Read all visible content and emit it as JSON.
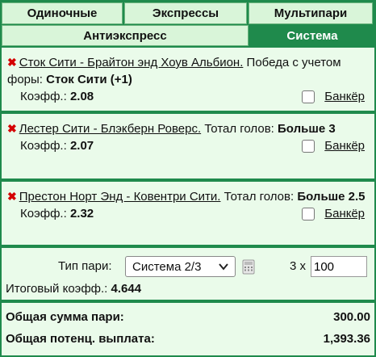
{
  "tabs": {
    "row1": [
      {
        "label": "Одиночные",
        "active": false
      },
      {
        "label": "Экспрессы",
        "active": false
      },
      {
        "label": "Мультипари",
        "active": false
      }
    ],
    "row2": [
      {
        "label": "Антиэкспресс",
        "active": false
      },
      {
        "label": "Система",
        "active": true
      }
    ]
  },
  "bets": [
    {
      "match": "Сток Сити - Брайтон энд Хоув Альбион.",
      "market": "Победа с учетом форы:",
      "selection": "Сток Сити (+1)",
      "coef_label": "Коэфф.:",
      "coef": "2.08",
      "banker_label": "Банкёр"
    },
    {
      "match": "Лестер Сити - Блэкберн Роверс.",
      "market": "Тотал голов:",
      "selection": "Больше 3",
      "coef_label": "Коэфф.:",
      "coef": "2.07",
      "banker_label": "Банкёр"
    },
    {
      "match": "Престон Норт Энд - Ковентри Сити.",
      "market": "Тотал голов:",
      "selection": "Больше 2.5",
      "coef_label": "Коэфф.:",
      "coef": "2.32",
      "banker_label": "Банкёр"
    }
  ],
  "system": {
    "type_label": "Тип пари:",
    "selected": "Система 2/3",
    "multiplier": "3 x",
    "stake_value": "100",
    "total_coef_label": "Итоговый коэфф.:",
    "total_coef": "4.644"
  },
  "summary": {
    "total_stake_label": "Общая сумма пари:",
    "total_stake": "300.00",
    "potential_payout_label": "Общая потенц. выплата:",
    "potential_payout": "1,393.36"
  },
  "colors": {
    "brand_green": "#1f8a4c",
    "tab_bg": "#d9f5d9",
    "panel_bg": "#eafbea",
    "remove_red": "#d40000"
  }
}
